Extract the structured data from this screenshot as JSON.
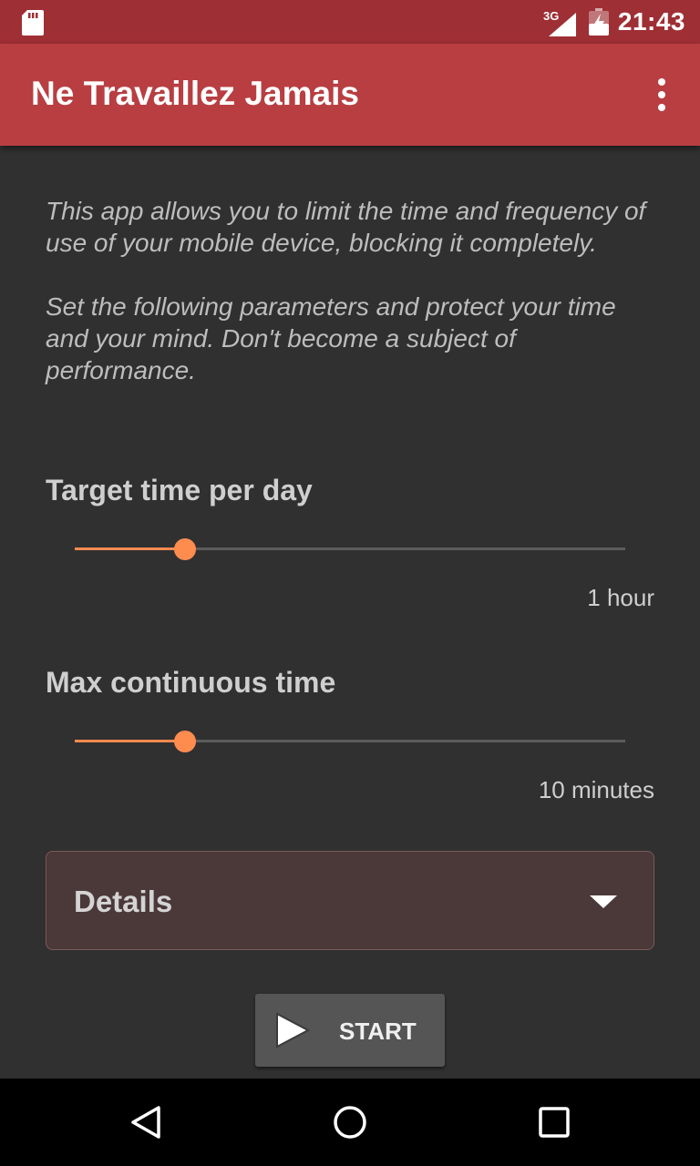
{
  "status_bar": {
    "network_label": "3G",
    "time": "21:43",
    "icons": [
      "sd-card-icon",
      "cellular-signal-icon",
      "battery-charging-icon"
    ]
  },
  "app_bar": {
    "title": "Ne Travaillez Jamais",
    "menu_icon": "overflow-menu-icon",
    "colors": {
      "status_bar": "#9e2f34",
      "app_bar": "#b83e42"
    }
  },
  "intro": {
    "paragraph_1": "This app allows you to limit the time and frequency of use of your mobile device, blocking it completely.",
    "paragraph_2": "Set the following parameters and protect your time and your mind. Don't become a subject of performance."
  },
  "target_time": {
    "label": "Target time per day",
    "value_text": "1 hour",
    "slider_fraction": 0.2
  },
  "max_continuous": {
    "label": "Max continuous time",
    "value_text": "10 minutes",
    "slider_fraction": 0.2
  },
  "details": {
    "label": "Details",
    "icon": "caret-down-icon"
  },
  "start_button": {
    "label": "START",
    "icon": "play-icon"
  },
  "accent_color": "#ff8c4f",
  "nav_bar": {
    "icons": [
      "back-icon",
      "home-icon",
      "recents-icon"
    ]
  }
}
